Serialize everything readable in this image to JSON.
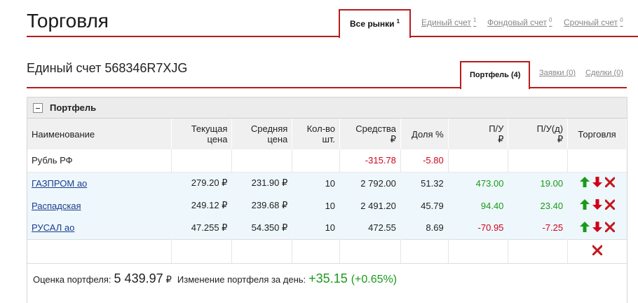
{
  "header": {
    "title": "Торговля",
    "tabs": [
      {
        "label": "Все рынки",
        "count": "1",
        "active": true
      },
      {
        "label": "Единый счет",
        "count": "1",
        "active": false
      },
      {
        "label": "Фондовый счет",
        "count": "0",
        "active": false
      },
      {
        "label": "Срочный счет",
        "count": "0",
        "active": false
      }
    ]
  },
  "account": {
    "title": "Единый счет 568346R7XJG",
    "tabs": [
      {
        "label": "Портфель (4)",
        "active": true
      },
      {
        "label": "Заявки (0)",
        "active": false
      },
      {
        "label": "Сделки (0)",
        "active": false
      }
    ]
  },
  "portfolio": {
    "title": "Портфель",
    "columns": {
      "name": "Наименование",
      "current_price": "Текущая цена",
      "avg_price": "Средняя цена",
      "qty": "Кол-во шт.",
      "funds": "Средства",
      "funds_unit": "₽",
      "share": "Доля %",
      "pl": "П/У",
      "pl_unit": "₽",
      "pl_day": "П/У(д)",
      "pl_day_unit": "₽",
      "trade": "Торговля"
    },
    "cash_row": {
      "name": "Рубль РФ",
      "funds": "-315.78",
      "share": "-5.80"
    },
    "rows": [
      {
        "name": "ГАЗПРОМ ао",
        "current_price": "279.20 ₽",
        "avg_price": "231.90 ₽",
        "qty": "10",
        "funds": "2 792.00",
        "share": "51.32",
        "pl": "473.00",
        "pl_day": "19.00"
      },
      {
        "name": "Распадская",
        "current_price": "249.12 ₽",
        "avg_price": "239.68 ₽",
        "qty": "10",
        "funds": "2 491.20",
        "share": "45.79",
        "pl": "94.40",
        "pl_day": "23.40"
      },
      {
        "name": "РУСАЛ ао",
        "current_price": "47.255 ₽",
        "avg_price": "54.350 ₽",
        "qty": "10",
        "funds": "472.55",
        "share": "8.69",
        "pl": "-70.95",
        "pl_day": "-7.25"
      }
    ],
    "summary": {
      "valuation_label": "Оценка портфеля:",
      "valuation": "5 439.97",
      "valuation_unit": "₽",
      "change_label": "Изменение портфеля за день:",
      "change": "+35.15",
      "change_pct": "(+0.65%)"
    }
  },
  "colors": {
    "accent": "#b71c1c",
    "positive": "#1a9a1a",
    "negative": "#d0021b",
    "row_highlight": "#eef7fb"
  },
  "icons": [
    "buy-arrow-up-icon",
    "sell-arrow-down-icon",
    "close-position-x-icon"
  ]
}
